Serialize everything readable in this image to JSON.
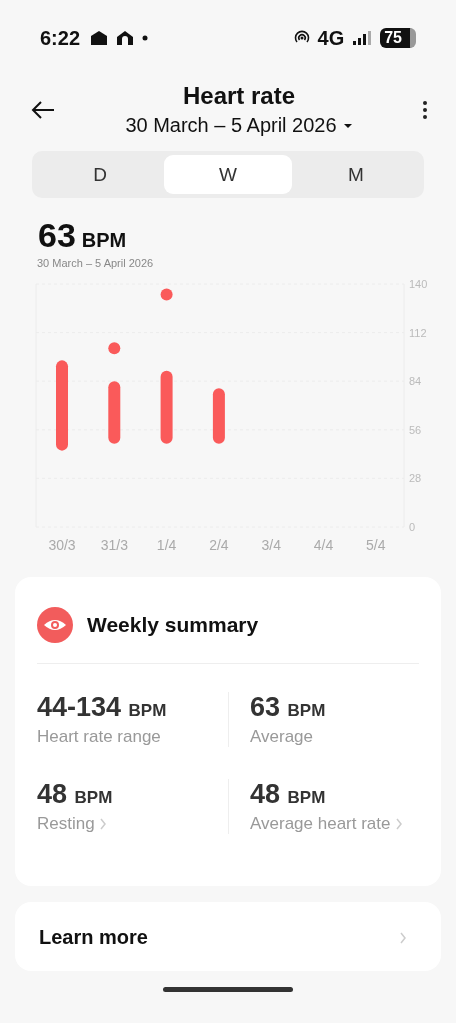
{
  "status_bar": {
    "time": "6:22",
    "network": "4G",
    "battery": "75"
  },
  "header": {
    "title": "Heart rate",
    "date_range": "30 March – 5 April 2026"
  },
  "tabs": [
    {
      "label": "D",
      "selected": false
    },
    {
      "label": "W",
      "selected": true
    },
    {
      "label": "M",
      "selected": false
    }
  ],
  "summary_value": {
    "value": "63",
    "unit": "BPM",
    "date": "30 March – 5 April 2026"
  },
  "chart_data": {
    "type": "bar",
    "categories": [
      "30/3",
      "31/3",
      "1/4",
      "2/4",
      "3/4",
      "4/4",
      "5/4"
    ],
    "ylim": [
      0,
      140
    ],
    "yticks": [
      0,
      28,
      56,
      84,
      112,
      140
    ],
    "grid": true,
    "series": [
      {
        "type": "candlestick",
        "color": "#fa5a5a",
        "ohlc": [
          [
            44,
            96,
            44,
            96
          ],
          [
            48,
            84,
            48,
            84
          ],
          [
            48,
            90,
            48,
            90
          ],
          [
            48,
            80,
            48,
            80
          ],
          null,
          null,
          null
        ]
      },
      {
        "type": "scatter",
        "color": "#fa5a5a",
        "values": [
          null,
          103,
          134,
          null,
          null,
          null,
          null
        ]
      }
    ]
  },
  "weekly_summary": {
    "title": "Weekly summary",
    "stats": [
      {
        "value": "44-134",
        "unit": "BPM",
        "label": "Heart rate range",
        "link": false
      },
      {
        "value": "63",
        "unit": "BPM",
        "label": "Average",
        "link": false
      },
      {
        "value": "48",
        "unit": "BPM",
        "label": "Resting",
        "link": true
      },
      {
        "value": "48",
        "unit": "BPM",
        "label": "Average heart rate",
        "link": true
      }
    ]
  },
  "learn_more": {
    "label": "Learn more"
  }
}
